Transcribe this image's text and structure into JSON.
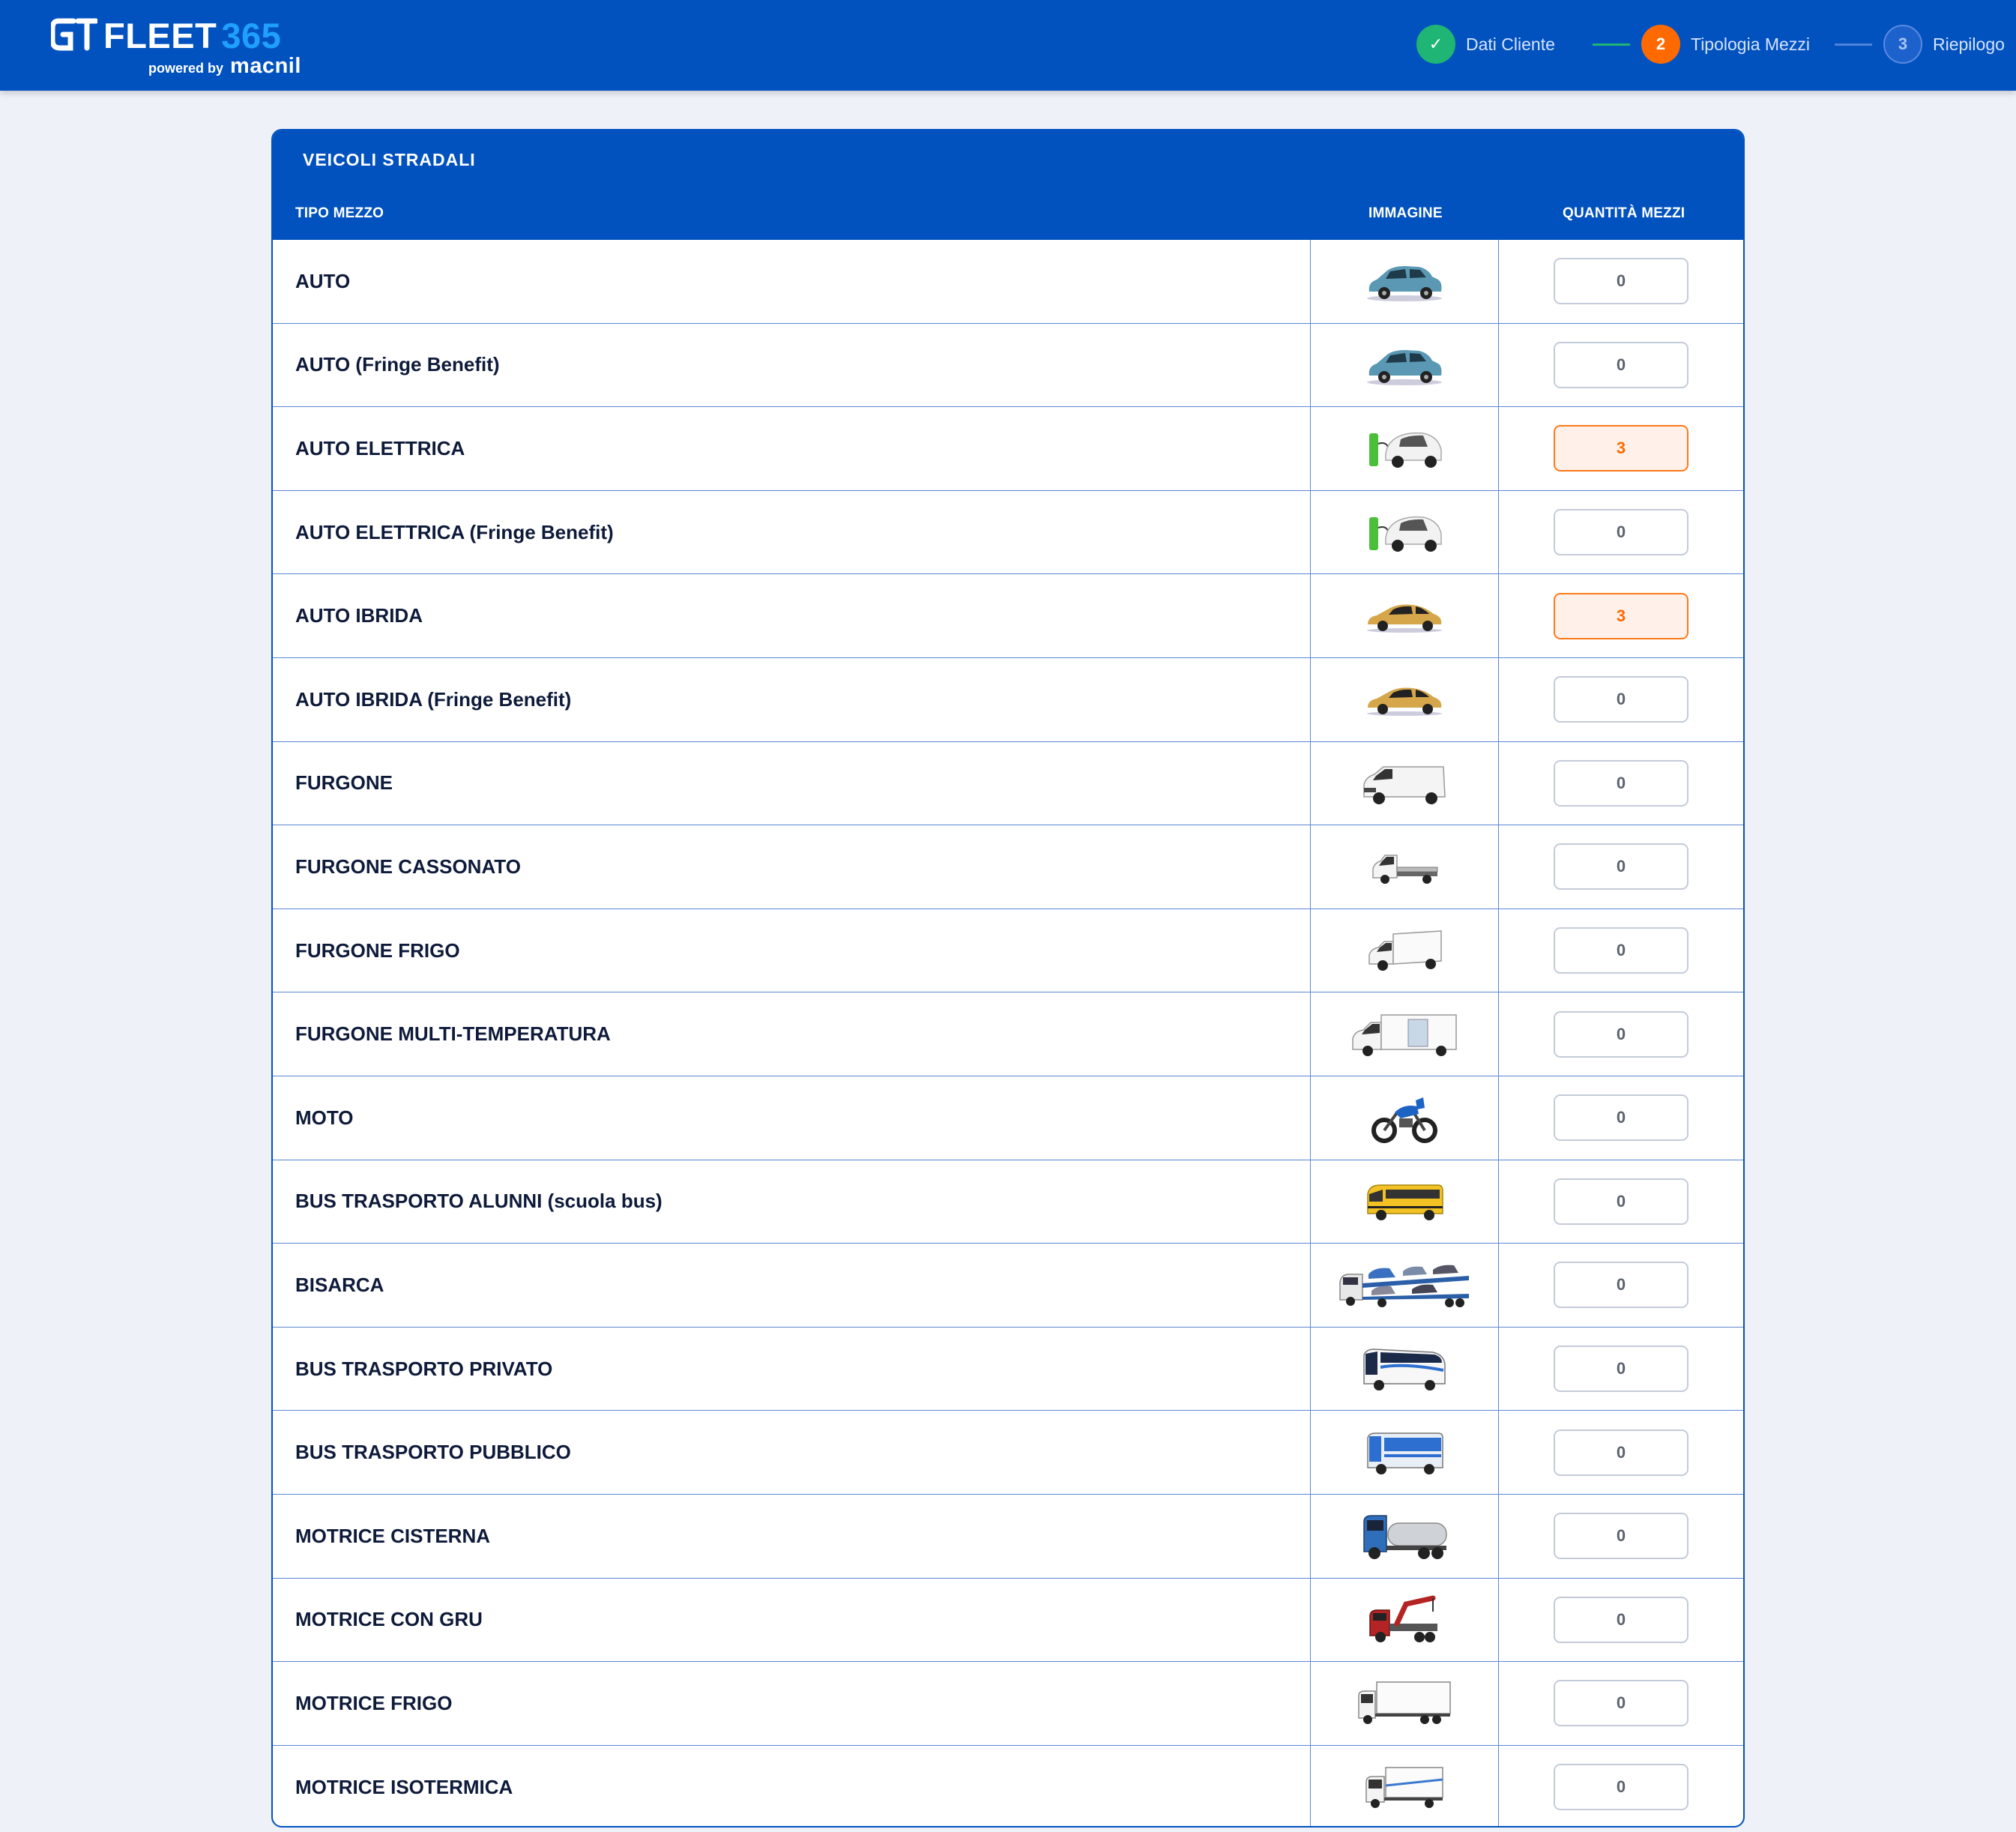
{
  "header": {
    "brand_name": "FLEET",
    "brand_number": "365",
    "powered_by": "powered by",
    "partner": "macnil",
    "colors": {
      "bar": "#0152bf",
      "accent_number": "#1fa0ff"
    }
  },
  "stepper": {
    "steps": [
      {
        "label": "Dati Cliente",
        "badge": "✓",
        "state": "done",
        "color": "#1fb574"
      },
      {
        "label": "Tipologia Mezzi",
        "badge": "2",
        "state": "current",
        "color": "#ff6a00"
      },
      {
        "label": "Riepilogo",
        "badge": "3",
        "state": "upcoming",
        "color": "#3d74d3"
      }
    ]
  },
  "table": {
    "title": "VEICOLI STRADALI",
    "columns": {
      "type": "TIPO MEZZO",
      "image": "IMMAGINE",
      "qty": "QUANTITÀ MEZZI"
    },
    "rows": [
      {
        "label": "AUTO",
        "icon": "suv-car-icon",
        "qty": "0"
      },
      {
        "label": "AUTO (Fringe Benefit)",
        "icon": "suv-car-icon",
        "qty": "0"
      },
      {
        "label": "AUTO ELETTRICA",
        "icon": "electric-car-icon",
        "qty": "3"
      },
      {
        "label": "AUTO ELETTRICA (Fringe Benefit)",
        "icon": "electric-car-icon",
        "qty": "0"
      },
      {
        "label": "AUTO IBRIDA",
        "icon": "hybrid-car-icon",
        "qty": "3"
      },
      {
        "label": "AUTO IBRIDA (Fringe Benefit)",
        "icon": "hybrid-car-icon",
        "qty": "0"
      },
      {
        "label": "FURGONE",
        "icon": "van-icon",
        "qty": "0"
      },
      {
        "label": "FURGONE CASSONATO",
        "icon": "flatbed-van-icon",
        "qty": "0"
      },
      {
        "label": "FURGONE FRIGO",
        "icon": "fridge-van-icon",
        "qty": "0"
      },
      {
        "label": "FURGONE MULTI-TEMPERATURA",
        "icon": "multi-temp-van-icon",
        "qty": "0"
      },
      {
        "label": "MOTO",
        "icon": "motorcycle-icon",
        "qty": "0"
      },
      {
        "label": "BUS TRASPORTO ALUNNI (scuola bus)",
        "icon": "school-bus-icon",
        "qty": "0"
      },
      {
        "label": "BISARCA",
        "icon": "car-carrier-icon",
        "qty": "0"
      },
      {
        "label": "BUS TRASPORTO PRIVATO",
        "icon": "coach-bus-icon",
        "qty": "0"
      },
      {
        "label": "BUS TRASPORTO PUBBLICO",
        "icon": "city-bus-icon",
        "qty": "0"
      },
      {
        "label": "MOTRICE CISTERNA",
        "icon": "tanker-truck-icon",
        "qty": "0"
      },
      {
        "label": "MOTRICE CON GRU",
        "icon": "crane-truck-icon",
        "qty": "0"
      },
      {
        "label": "MOTRICE FRIGO",
        "icon": "reefer-truck-icon",
        "qty": "0"
      },
      {
        "label": "MOTRICE ISOTERMICA",
        "icon": "isothermal-truck-icon",
        "qty": "0"
      }
    ]
  }
}
